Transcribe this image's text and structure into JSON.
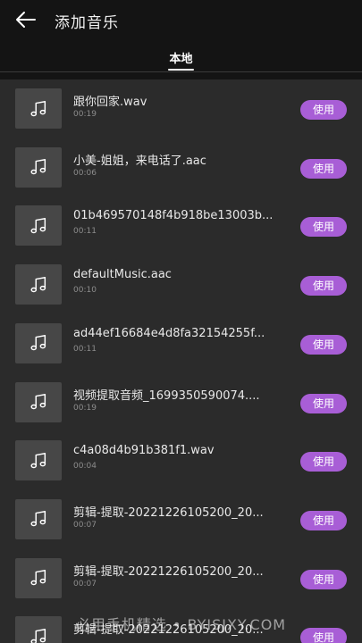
{
  "header": {
    "title": "添加音乐",
    "back_icon": "arrow-left-icon"
  },
  "tabs": [
    {
      "label": "本地",
      "active": true
    }
  ],
  "accent_color": "#a85ed6",
  "items": [
    {
      "name": "跟你回家.wav",
      "duration": "00:19",
      "action": "使用"
    },
    {
      "name": "小美-姐姐，来电话了.aac",
      "duration": "00:06",
      "action": "使用"
    },
    {
      "name": "01b469570148f4b918be13003b...",
      "duration": "00:11",
      "action": "使用"
    },
    {
      "name": "defaultMusic.aac",
      "duration": "00:10",
      "action": "使用"
    },
    {
      "name": "ad44ef16684e4d8fa32154255f...",
      "duration": "00:11",
      "action": "使用"
    },
    {
      "name": "视频提取音频_1699350590074....",
      "duration": "00:19",
      "action": "使用"
    },
    {
      "name": "c4a08d4b91b381f1.wav",
      "duration": "00:04",
      "action": "使用"
    },
    {
      "name": "剪辑-提取-20221226105200_20...",
      "duration": "00:07",
      "action": "使用"
    },
    {
      "name": "剪辑-提取-20221226105200_20...",
      "duration": "00:07",
      "action": "使用"
    },
    {
      "name": "剪辑-提取-20221226105200_20...",
      "duration": "",
      "action": "使用"
    }
  ],
  "watermark": "必用手机精选 • BYISJXY.COM"
}
